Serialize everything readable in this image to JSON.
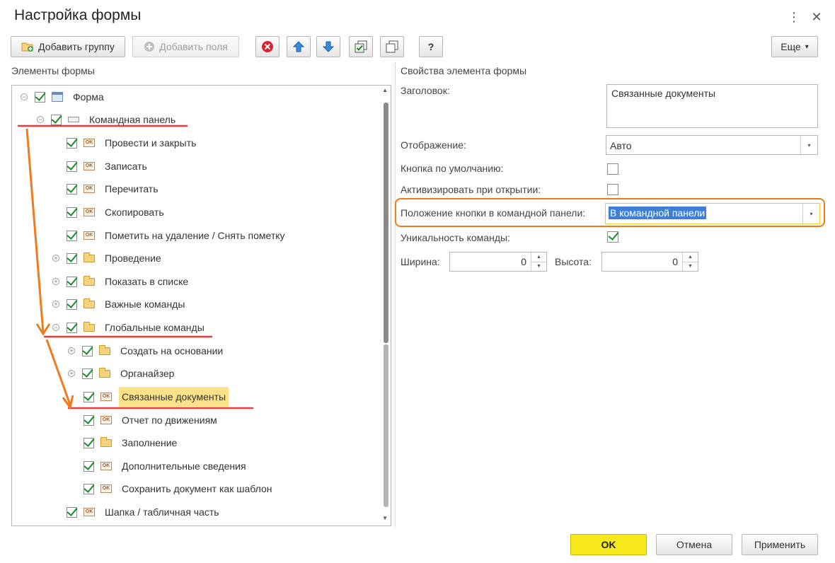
{
  "window": {
    "title": "Настройка формы",
    "more_icon": "⋮",
    "close_icon": "✕"
  },
  "toolbar": {
    "add_group": "Добавить группу",
    "add_fields": "Добавить поля",
    "help": "?",
    "more": "Еще",
    "more_arrow": "▾"
  },
  "left": {
    "section_label": "Элементы формы",
    "tree": [
      {
        "label": "Форма"
      },
      {
        "label": "Командная панель"
      },
      {
        "label": "Провести и закрыть"
      },
      {
        "label": "Записать"
      },
      {
        "label": "Перечитать"
      },
      {
        "label": "Скопировать"
      },
      {
        "label": "Пометить на удаление / Снять пометку"
      },
      {
        "label": "Проведение"
      },
      {
        "label": "Показать в списке"
      },
      {
        "label": "Важные команды"
      },
      {
        "label": "Глобальные команды"
      },
      {
        "label": "Создать на основании"
      },
      {
        "label": "Органайзер"
      },
      {
        "label": "Связанные документы"
      },
      {
        "label": "Отчет по движениям"
      },
      {
        "label": "Заполнение"
      },
      {
        "label": "Дополнительные сведения"
      },
      {
        "label": "Сохранить документ как шаблон"
      },
      {
        "label": "Шапка / табличная часть"
      }
    ]
  },
  "right": {
    "section_label": "Свойства элемента формы",
    "caption_label": "Заголовок:",
    "caption_value": "Связанные документы",
    "display_label": "Отображение:",
    "display_value": "Авто",
    "default_button_label": "Кнопка по умолчанию:",
    "activate_label": "Активизировать при открытии:",
    "position_label": "Положение кнопки в командной панели:",
    "position_value": "В командной панели",
    "unique_label": "Уникальность команды:",
    "width_label": "Ширина:",
    "width_value": "0",
    "height_label": "Высота:",
    "height_value": "0"
  },
  "footer": {
    "ok": "OK",
    "cancel": "Отмена",
    "apply": "Применить"
  },
  "colors": {
    "annotation_red": "#f0393a",
    "annotation_orange": "#f07a1c",
    "selection": "#fbe18a",
    "ok_button": "#f6e81a"
  }
}
